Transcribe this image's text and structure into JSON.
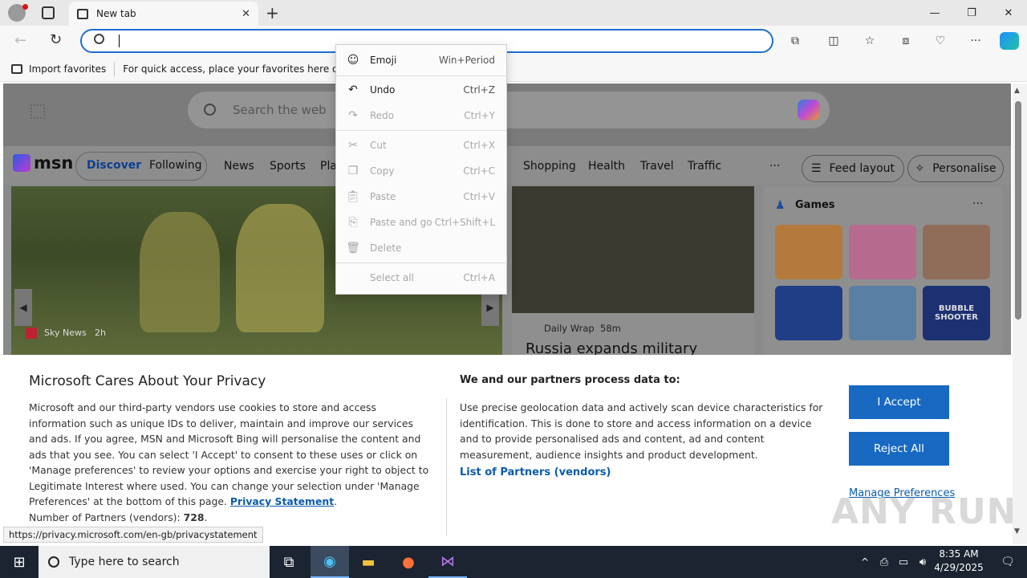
{
  "browser": {
    "tab_title": "New tab",
    "favorites_bar": {
      "import_label": "Import favorites",
      "hint": "For quick access, place your favorites here on the fav"
    }
  },
  "msn": {
    "search_placeholder": "Search the web",
    "logo": "msn",
    "nav_pills": [
      "Discover",
      "Following"
    ],
    "nav_items": [
      "News",
      "Sports",
      "Pla",
      "Shopping",
      "Health",
      "Travel",
      "Traffic"
    ],
    "more": "···",
    "feed_layout": "Feed layout",
    "personalise": "Personalise",
    "hero_source": "Sky News",
    "hero_time": "2h",
    "card2_source": "Daily Wrap",
    "card2_time": "58m",
    "card2_title": "Russia expands military",
    "games_title": "Games",
    "game_bubble": "BUBBLE SHOOTER"
  },
  "context_menu": {
    "items": [
      {
        "label": "Emoji",
        "shortcut": "Win+Period",
        "icon": "smiley-icon",
        "disabled": false
      },
      {
        "label": "Undo",
        "shortcut": "Ctrl+Z",
        "icon": "undo-icon",
        "disabled": false
      },
      {
        "label": "Redo",
        "shortcut": "Ctrl+Y",
        "icon": "redo-icon",
        "disabled": true
      },
      {
        "label": "Cut",
        "shortcut": "Ctrl+X",
        "icon": "scissors-icon",
        "disabled": true
      },
      {
        "label": "Copy",
        "shortcut": "Ctrl+C",
        "icon": "copy-icon",
        "disabled": true
      },
      {
        "label": "Paste",
        "shortcut": "Ctrl+V",
        "icon": "paste-icon",
        "disabled": true
      },
      {
        "label": "Paste and go",
        "shortcut": "Ctrl+Shift+L",
        "icon": "paste-go-icon",
        "disabled": true
      },
      {
        "label": "Delete",
        "shortcut": "",
        "icon": "trash-icon",
        "disabled": true
      },
      {
        "label": "Select all",
        "shortcut": "Ctrl+A",
        "icon": "",
        "disabled": true
      }
    ]
  },
  "privacy": {
    "title": "Microsoft Cares About Your Privacy",
    "body": "Microsoft and our third-party vendors use cookies to store and access information such as unique IDs to deliver, maintain and improve our services and ads. If you agree, MSN and Microsoft Bing will personalise the content and ads that you see. You can select 'I Accept' to consent to these uses or click on 'Manage preferences' to review your options and exercise your right to object to Legitimate Interest where used.  You can change your selection under 'Manage Preferences' at the bottom of this page.",
    "privacy_link": "Privacy Statement",
    "partners_count_label": "Number of Partners (vendors):",
    "partners_count": "728",
    "process_title": "We and our partners process data to:",
    "process_body": "Use precise geolocation data and actively scan device characteristics for identification. This is done to store and access information on a device and to provide personalised ads and content, ad and content measurement, audience insights and product development.",
    "partners_link": "List of Partners (vendors)",
    "accept": "I Accept",
    "reject": "Reject All",
    "manage": "Manage Preferences"
  },
  "status_url": "https://privacy.microsoft.com/en-gb/privacystatement",
  "watermark": "ANY RUN",
  "taskbar": {
    "search_placeholder": "Type here to search",
    "time": "8:35 AM",
    "date": "4/29/2025"
  }
}
